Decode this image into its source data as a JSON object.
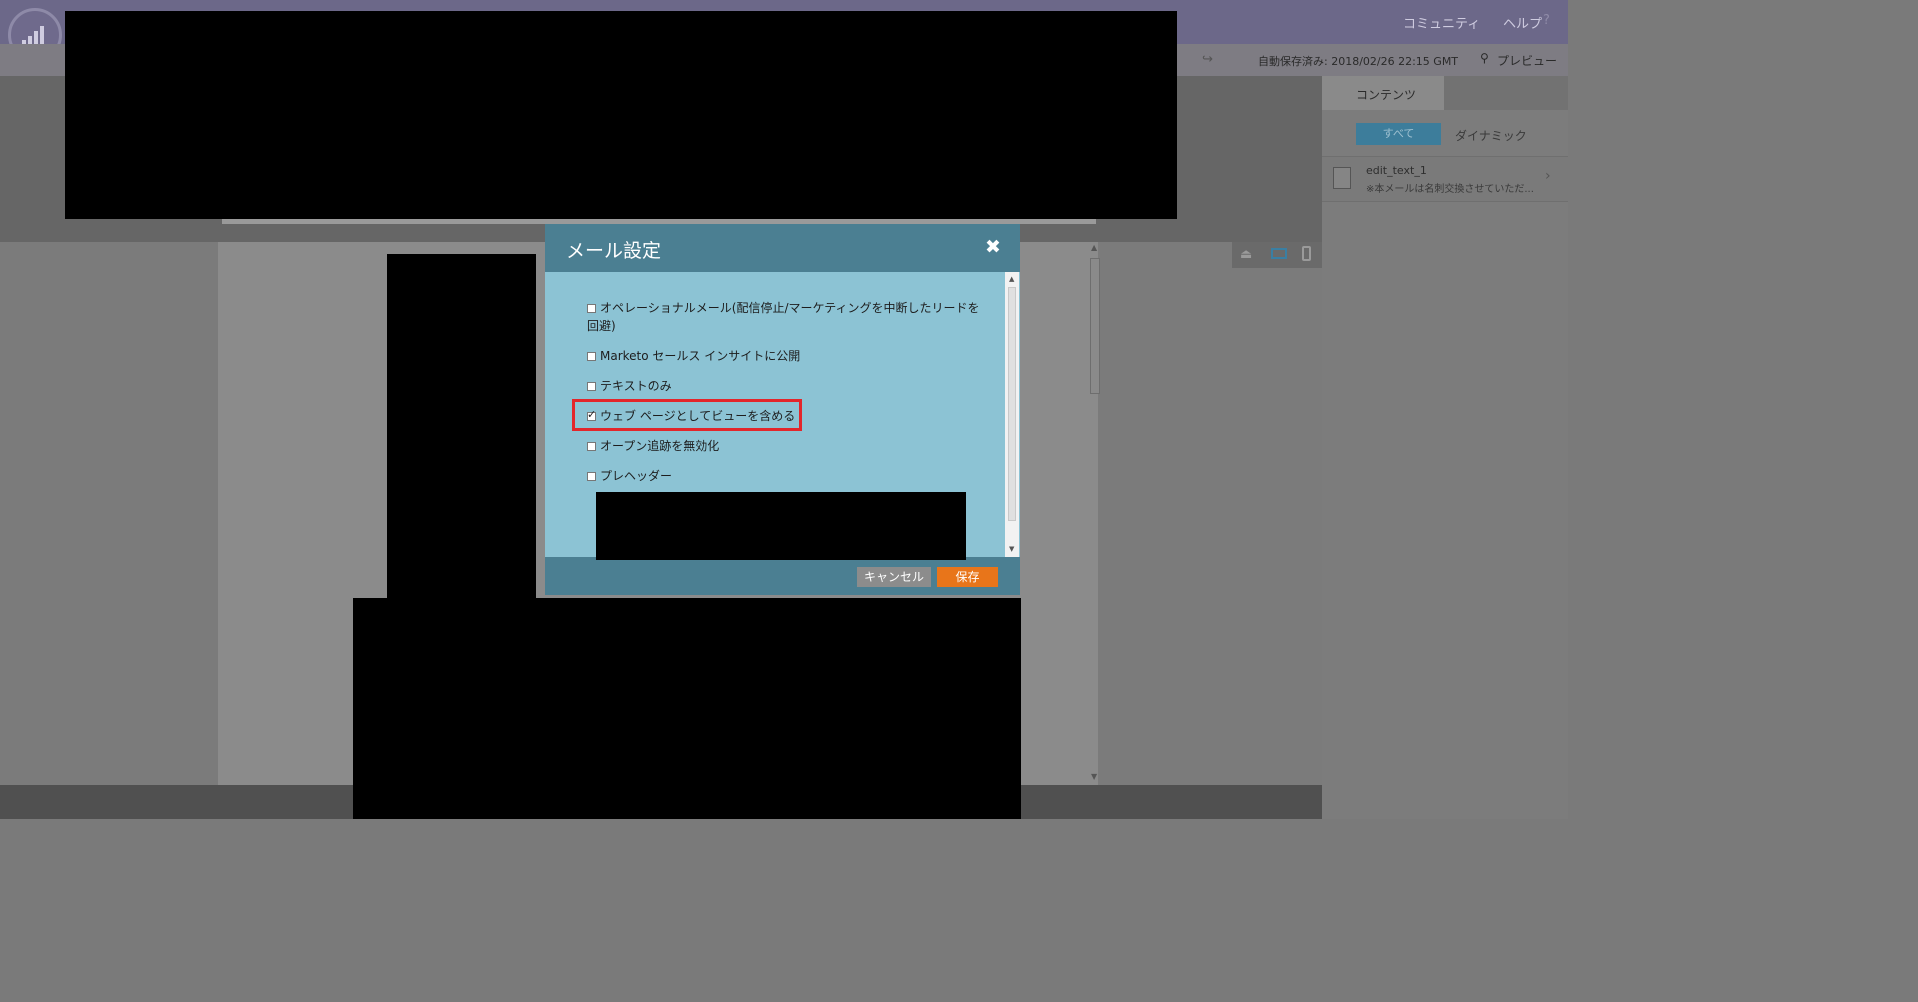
{
  "header": {
    "community": "コミュニティ",
    "help": "ヘルプ"
  },
  "toolbar": {
    "autosave": "自動保存済み: 2018/02/26 22:15 GMT",
    "preview": "プレビュー"
  },
  "panel": {
    "tab_content": "コンテンツ",
    "filter_all": "すべて",
    "filter_dynamic": "ダイナミック",
    "item_title": "edit_text_1",
    "item_subtitle": "※本メールは名刺交換させていただ..."
  },
  "dialog": {
    "title": "メール設定",
    "options": [
      {
        "label": "オペレーショナルメール(配信停止/マーケティングを中断したリードを",
        "label2": "回避)",
        "checked": false
      },
      {
        "label": "Marketo セールス インサイトに公開",
        "checked": false
      },
      {
        "label": "テキストのみ",
        "checked": false
      },
      {
        "label": "ウェブ ページとしてビューを含める",
        "checked": true
      },
      {
        "label": "オープン追跡を無効化",
        "checked": false
      },
      {
        "label": "プレヘッダー",
        "checked": false
      }
    ],
    "cancel": "キャンセル",
    "save": "保存"
  },
  "colors": {
    "dialog_header": "#4b7f92",
    "dialog_body": "#8cc3d4",
    "save_button": "#e8751a",
    "highlight": "#e3262b"
  }
}
